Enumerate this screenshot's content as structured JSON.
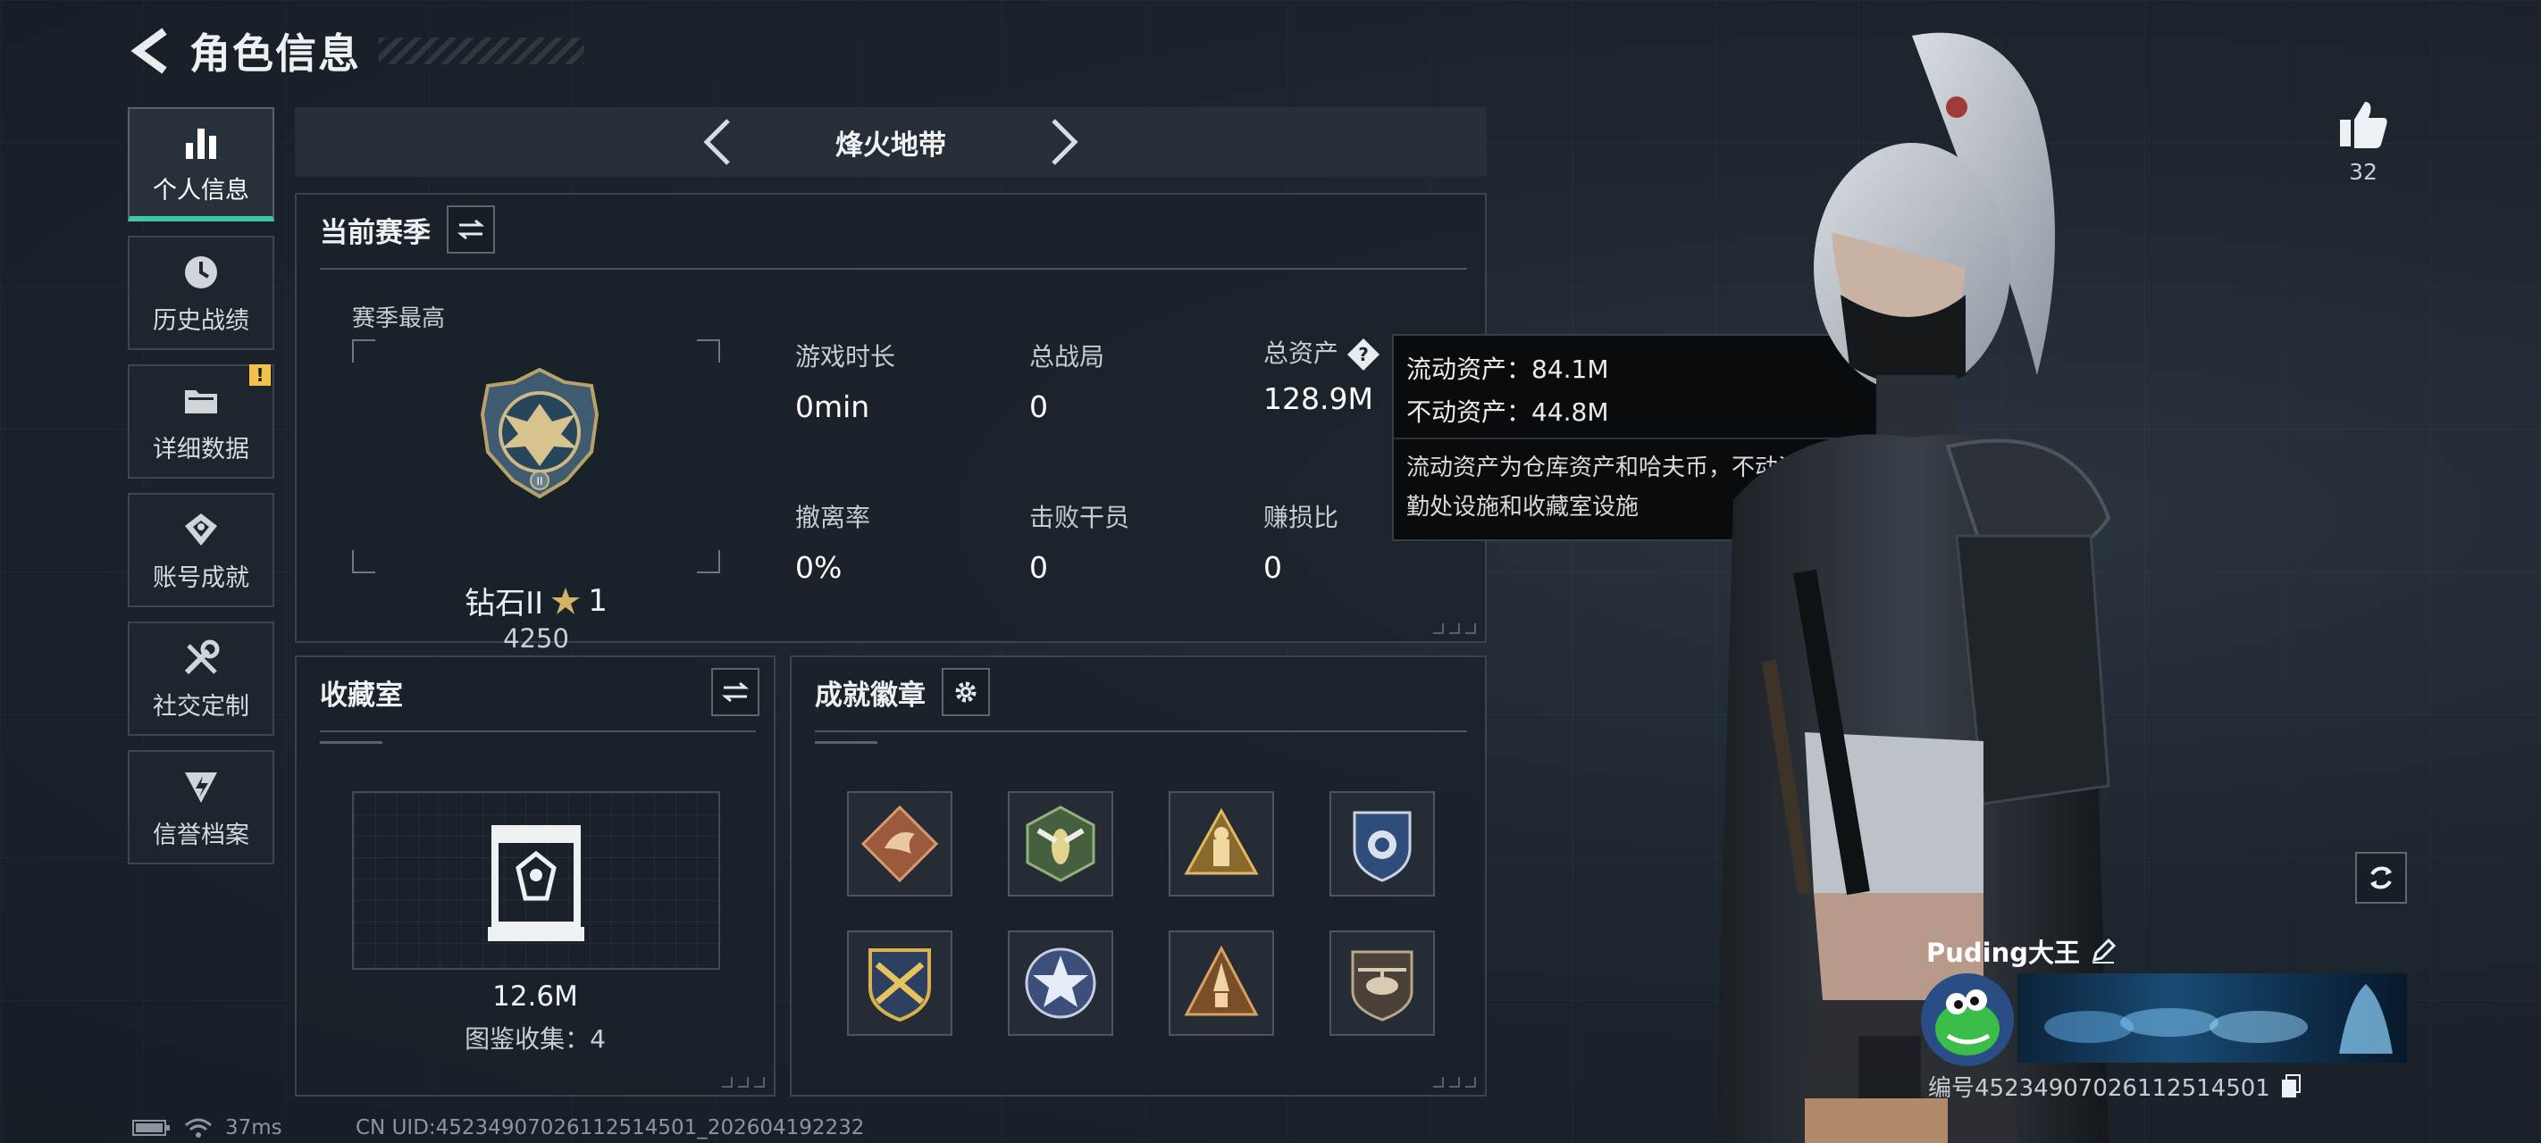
{
  "header": {
    "title": "角色信息"
  },
  "sidebar": {
    "items": [
      {
        "label": "个人信息",
        "icon": "bar-chart-icon",
        "active": true
      },
      {
        "label": "历史战绩",
        "icon": "clock-icon"
      },
      {
        "label": "详细数据",
        "icon": "folder-icon",
        "badge": "!"
      },
      {
        "label": "账号成就",
        "icon": "achievement-icon"
      },
      {
        "label": "社交定制",
        "icon": "wrench-icon"
      },
      {
        "label": "信誉档案",
        "icon": "shield-bolt-icon"
      }
    ]
  },
  "mode_selector": {
    "current": "烽火地带"
  },
  "season": {
    "title": "当前赛季",
    "best_label": "赛季最高",
    "rank_name": "钻石II",
    "rank_stars": "1",
    "rank_score": "4250",
    "stats": [
      {
        "label": "游戏时长",
        "value": "0min"
      },
      {
        "label": "总战局",
        "value": "0"
      },
      {
        "label": "总资产",
        "value": "128.9M",
        "help": true
      },
      {
        "label": "撤离率",
        "value": "0%"
      },
      {
        "label": "击败干员",
        "value": "0"
      },
      {
        "label": "赚损比",
        "value": "0"
      }
    ]
  },
  "tooltip": {
    "liquid": "流动资产：84.1M",
    "fixed": "不动资产：44.8M",
    "note": "流动资产为仓库资产和哈夫币，不动资产为特勤处设施和收藏室设施"
  },
  "collection": {
    "title": "收藏室",
    "value": "12.6M",
    "count_text": "图鉴收集：4"
  },
  "badges": {
    "title": "成就徽章",
    "items": [
      {
        "icon": "dragon-badge-icon",
        "color": "#b06a48"
      },
      {
        "icon": "wasp-badge-icon",
        "color": "#6f8b5a"
      },
      {
        "icon": "triangle-soldier-badge-icon",
        "color": "#b78a3e"
      },
      {
        "icon": "police-shield-badge-icon",
        "color": "#3f5f8c"
      },
      {
        "icon": "crossed-guns-badge-icon",
        "color": "#c69a3b"
      },
      {
        "icon": "star-medal-badge-icon",
        "color": "#6b7fa6"
      },
      {
        "icon": "rocket-badge-icon",
        "color": "#b0703c"
      },
      {
        "icon": "helicopter-badge-icon",
        "color": "#8c7a62"
      }
    ]
  },
  "profile": {
    "likes": "32",
    "name": "Puding大王",
    "id_text": "编号4523490702611251450​1"
  },
  "status_bar": {
    "ping": "37ms",
    "uid": "CN UID:4523490702611251450​1_202604192232"
  },
  "colors": {
    "accent": "#3fc7a4",
    "panel_border": "#3a444d",
    "gold": "#d4b266"
  }
}
